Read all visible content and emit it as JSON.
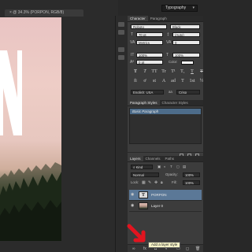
{
  "app": {
    "workspace_label": "Typography",
    "doc_tab_title": "× @ 34.3% (PORPON, RGB/8)"
  },
  "canvas": {
    "big_letter": "N"
  },
  "character_panel": {
    "tabs": [
      "Character",
      "Paragraph"
    ],
    "font_family": "Roboto",
    "font_style": "Black",
    "font_size": "70 pt",
    "leading": "(Auto)",
    "kerning": "Metrics",
    "tracking": "0",
    "vertical_scale": "100%",
    "horizontal_scale": "100%",
    "baseline_shift": "0 pt",
    "color_label": "Color:",
    "type_styles": [
      "T",
      "T",
      "TT",
      "Tr",
      "T¹",
      "T₁",
      "T",
      "T"
    ],
    "opentype": [
      "fi",
      "ơ",
      "st",
      "A",
      "ad",
      "T",
      "1st",
      "½"
    ],
    "language": "English: USA",
    "anti_alias_icon": "aa",
    "anti_alias": "Crisp"
  },
  "paragraph_styles_panel": {
    "tabs": [
      "Paragraph Styles",
      "Character Styles"
    ],
    "styles": [
      "Basic Paragraph"
    ]
  },
  "layers_panel": {
    "tabs": [
      "Layers",
      "Channels",
      "Paths"
    ],
    "filter": "Kind",
    "blend_mode": "Normal",
    "opacity_label": "Opacity:",
    "opacity": "100%",
    "lock_label": "Lock:",
    "fill_label": "Fill:",
    "fill": "100%",
    "layers": [
      {
        "name": "PORPON",
        "type": "text",
        "selected": true
      },
      {
        "name": "Layer 0",
        "type": "image",
        "selected": false
      }
    ]
  },
  "tooltip": "Add a layer style",
  "colors": {
    "selection": "#5b7897",
    "tooltip_bg": "#f4f1c6",
    "arrow": "#e2141f"
  }
}
